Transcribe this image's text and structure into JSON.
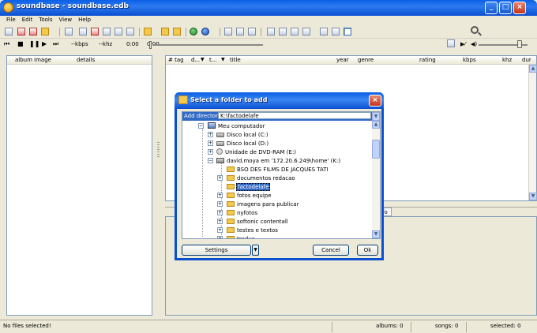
{
  "window": {
    "title": "soundbase - soundbase.edb"
  },
  "menu": [
    "File",
    "Edit",
    "Tools",
    "View",
    "Help"
  ],
  "transport": {
    "kbps": "--kbps",
    "khz": "--khz",
    "time_current": "0:00",
    "time_total": "0:00"
  },
  "left_panel": {
    "columns": [
      "album image",
      "details"
    ]
  },
  "track_list": {
    "columns": [
      "# tag",
      "d...",
      "t...",
      "title",
      "year",
      "genre",
      "rating",
      "kbps",
      "khz",
      "dur"
    ]
  },
  "bottom_tab": {
    "label": "fo"
  },
  "dialog": {
    "title": "Select a folder to add",
    "address_label": "Add directory",
    "address_value": "K:\\factodelafe",
    "tree": [
      {
        "label": "Meu computador",
        "icon": "computer-icon"
      },
      {
        "label": "Disco local (C:)",
        "icon": "drive-icon"
      },
      {
        "label": "Disco local (D:)",
        "icon": "drive-icon"
      },
      {
        "label": "Unidade de DVD-RAM (E:)",
        "icon": "dvd-icon"
      },
      {
        "label": "david.moya em '172.20.6.249\\home' (K:)",
        "icon": "network-drive-icon"
      },
      {
        "label": "BSO DES FILMS DE JACQUES TATI",
        "icon": "folder-icon"
      },
      {
        "label": "documentos redacao",
        "icon": "folder-icon"
      },
      {
        "label": "factodelafe",
        "icon": "folder-icon",
        "selected": true
      },
      {
        "label": "fotos equipe",
        "icon": "folder-icon"
      },
      {
        "label": "imagens para publicar",
        "icon": "folder-icon"
      },
      {
        "label": "nyfotos",
        "icon": "folder-icon"
      },
      {
        "label": "softonic contentall",
        "icon": "folder-icon"
      },
      {
        "label": "testes e textos",
        "icon": "folder-icon"
      },
      {
        "label": "traduc",
        "icon": "folder-icon"
      }
    ],
    "settings_label": "Settings",
    "cancel_label": "Cancel",
    "ok_label": "Ok"
  },
  "status": {
    "files": "No files selected!",
    "albums": "albums: 0",
    "songs": "songs: 0",
    "selected": "selected: 0"
  }
}
